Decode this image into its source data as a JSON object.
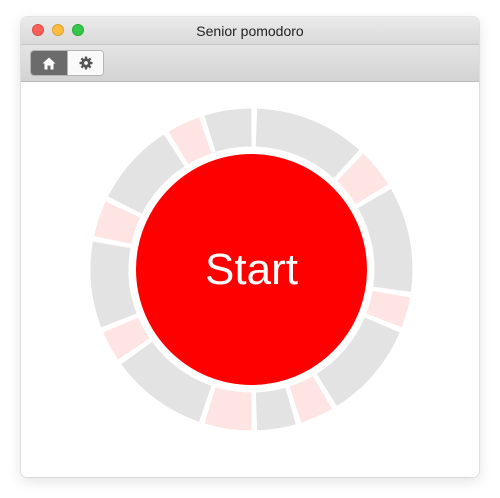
{
  "window": {
    "title": "Senior pomodoro"
  },
  "toolbar": {
    "tabs": [
      {
        "icon": "home-icon",
        "selected": true
      },
      {
        "icon": "gear-icon",
        "selected": false
      }
    ]
  },
  "main": {
    "start_label": "Start"
  },
  "colors": {
    "accent": "#ff0000",
    "work_segment": "#e3e3e3",
    "break_segment": "#ffe4e4"
  }
}
